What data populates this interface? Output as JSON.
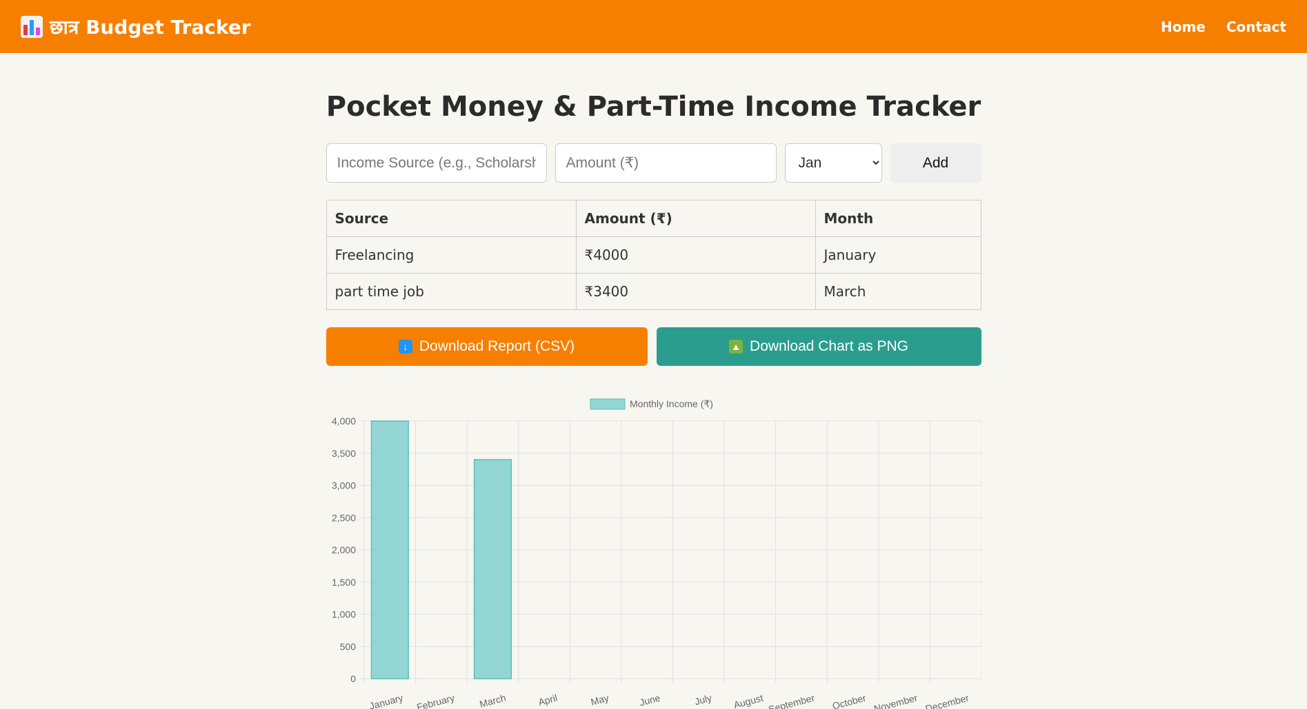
{
  "nav": {
    "brand": "छात्र Budget Tracker",
    "links": [
      "Home",
      "Contact"
    ]
  },
  "page": {
    "title": "Pocket Money & Part-Time Income Tracker"
  },
  "form": {
    "source_placeholder": "Income Source (e.g., Scholarship)",
    "amount_placeholder": "Amount (₹)",
    "month_selected": "Jan",
    "month_options": [
      "Jan"
    ],
    "add_label": "Add"
  },
  "table": {
    "headers": [
      "Source",
      "Amount (₹)",
      "Month"
    ],
    "rows": [
      [
        "Freelancing",
        "₹4000",
        "January"
      ],
      [
        "part time job",
        "₹3400",
        "March"
      ]
    ]
  },
  "buttons": {
    "csv_label": "Download Report (CSV)",
    "png_label": "Download Chart as PNG"
  },
  "colors": {
    "primary": "#f77f00",
    "teal": "#2a9d8f",
    "bar_fill": "#93d6d3",
    "bar_stroke": "#5bbcb7"
  },
  "chart_data": {
    "type": "bar",
    "categories": [
      "January",
      "February",
      "March",
      "April",
      "May",
      "June",
      "July",
      "August",
      "September",
      "October",
      "November",
      "December"
    ],
    "series": [
      {
        "name": "Monthly Income (₹)",
        "values": [
          4000,
          0,
          3400,
          0,
          0,
          0,
          0,
          0,
          0,
          0,
          0,
          0
        ]
      }
    ],
    "ylim": [
      0,
      4000
    ],
    "yticks": [
      "0",
      "500",
      "1,000",
      "1,500",
      "2,000",
      "2,500",
      "3,000",
      "3,500",
      "4,000"
    ],
    "grid": true,
    "legend": "top"
  }
}
